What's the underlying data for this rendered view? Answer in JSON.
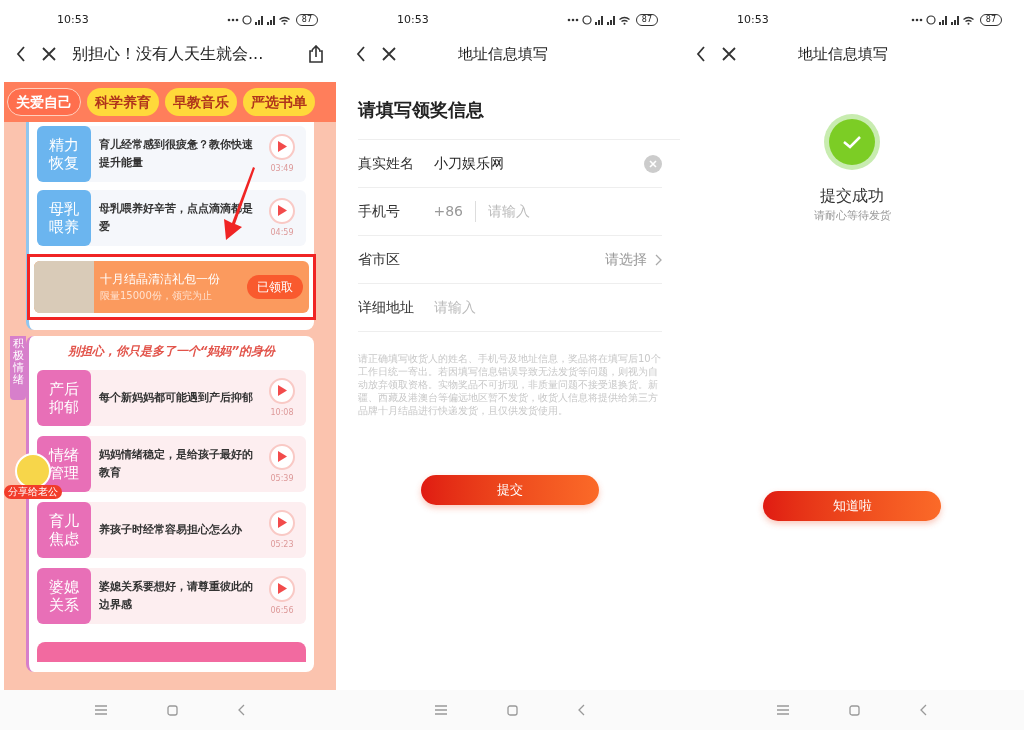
{
  "screens": [
    {
      "kind": "article",
      "status_bar": {
        "time": "10:53",
        "battery": "87"
      },
      "nav": {
        "title": "别担心！没有人天生就会..."
      },
      "tabs": [
        {
          "label": "关爱自己",
          "selected": true
        },
        {
          "label": "科学养育",
          "selected": false
        },
        {
          "label": "早教音乐",
          "selected": false
        },
        {
          "label": "严选书单",
          "selected": false
        }
      ],
      "lessons": [
        {
          "tag": "精力恢复",
          "title": "育儿经常感到很疲惫？教你快速提升能量",
          "duration": "03:49"
        },
        {
          "tag": "母乳喂养",
          "title": "母乳喂养好辛苦，点点滴滴都是爱",
          "duration": "04:59"
        }
      ],
      "prize": {
        "title": "十月结晶清洁礼包一份",
        "subtitle": "限量15000份，领完为止",
        "button": "已领取",
        "highlighted": true
      },
      "side_tab": "积极情绪",
      "section": {
        "heading": "别担心，你只是多了一个“妈妈”的身份",
        "lessons": [
          {
            "tag": "产后抑郁",
            "title": "每个新妈妈都可能遇到产后抑郁",
            "duration": "10:08"
          },
          {
            "tag": "情绪管理",
            "title": "妈妈情绪稳定，是给孩子最好的教育",
            "duration": "05:39"
          },
          {
            "tag": "育儿焦虑",
            "title": "养孩子时经常容易担心怎么办",
            "duration": "05:23"
          },
          {
            "tag": "婆媳关系",
            "title": "婆媳关系要想好，请尊重彼此的边界感",
            "duration": "06:56"
          }
        ]
      },
      "share_badge": "分享给老公"
    },
    {
      "kind": "form",
      "status_bar": {
        "time": "10:53",
        "battery": "87"
      },
      "nav": {
        "title": "地址信息填写"
      },
      "heading": "请填写领奖信息",
      "fields": [
        {
          "kind": "text",
          "label": "真实姓名",
          "value": "小刀娱乐网"
        },
        {
          "kind": "phone",
          "label": "手机号",
          "prefix": "+86",
          "placeholder": "请输入"
        },
        {
          "kind": "select",
          "label": "省市区",
          "placeholder": "请选择"
        },
        {
          "kind": "text",
          "label": "详细地址",
          "placeholder": "请输入"
        }
      ],
      "notice": "请正确填写收货人的姓名、手机号及地址信息，奖品将在填写后10个工作日统一寄出。若因填写信息错误导致无法发货等问题，则视为自动放弃领取资格。实物奖品不可折现，非质量问题不接受退换货。新疆、西藏及港澳台等偏远地区暂不发货，收货人信息将提供给第三方品牌十月结晶进行快递发货，且仅供发货使用。",
      "button": "提交"
    },
    {
      "kind": "success",
      "status_bar": {
        "time": "10:53",
        "battery": "87"
      },
      "nav": {
        "title": "地址信息填写"
      },
      "title": "提交成功",
      "subtitle": "请耐心等待发货",
      "button": "知道啦"
    }
  ]
}
